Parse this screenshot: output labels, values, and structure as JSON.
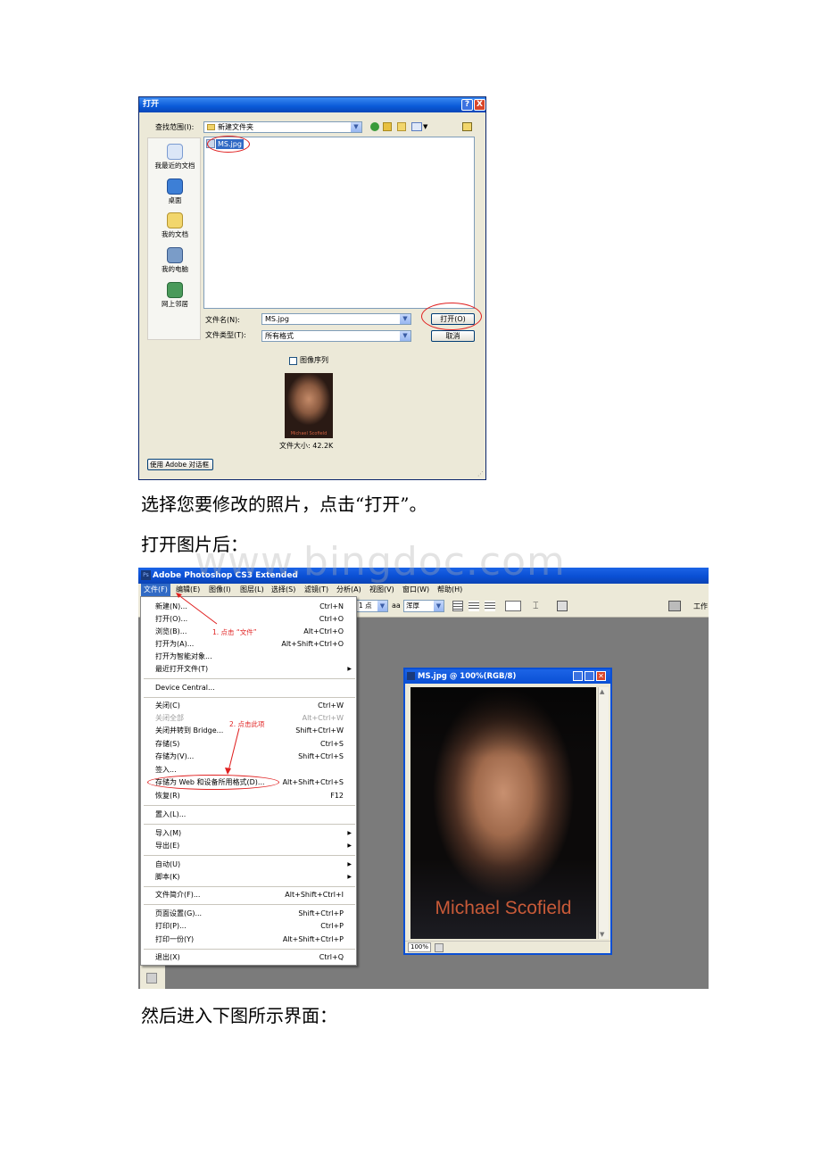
{
  "open_dialog": {
    "title": "打开",
    "help_btn": "?",
    "close_btn": "X",
    "look_in_label": "查找范围(I):",
    "look_in_value": "新建文件夹",
    "places": [
      "我最近的文档",
      "桌面",
      "我的文档",
      "我的电脑",
      "网上邻居"
    ],
    "file_item": "MS.jpg",
    "filename_label": "文件名(N):",
    "filename_value": "MS.jpg",
    "filetype_label": "文件类型(T):",
    "filetype_value": "所有格式",
    "open_button": "打开(O)",
    "cancel_button": "取消",
    "image_sequence_label": "图像序列",
    "file_size": "文件大小: 42.2K",
    "adobe_dialog_button": "使用 Adobe 对话框",
    "preview_caption": "Michael Scofield"
  },
  "paragraph1": "选择您要修改的照片，点击“打开”。",
  "paragraph2": "打开图片后：",
  "watermark": "www.bingdoc.com",
  "photoshop": {
    "title": "Adobe Photoshop CS3 Extended",
    "menubar": [
      "文件(F)",
      "编辑(E)",
      "图像(I)",
      "图层(L)",
      "选择(S)",
      "滤镜(T)",
      "分析(A)",
      "视图(V)",
      "窗口(W)",
      "帮助(H)"
    ],
    "options": {
      "size_value": "1 点",
      "aa_label": "aa",
      "aa_value": "浑厚",
      "workspace_label": "工作"
    },
    "file_menu": [
      {
        "label": "新建(N)...",
        "shortcut": "Ctrl+N"
      },
      {
        "label": "打开(O)...",
        "shortcut": "Ctrl+O"
      },
      {
        "label": "浏览(B)...",
        "shortcut": "Alt+Ctrl+O"
      },
      {
        "label": "打开为(A)...",
        "shortcut": "Alt+Shift+Ctrl+O"
      },
      {
        "label": "打开为智能对象...",
        "shortcut": ""
      },
      {
        "label": "最近打开文件(T)",
        "shortcut": "",
        "submenu": true
      },
      {
        "label": "Device Central...",
        "shortcut": ""
      },
      {
        "label": "关闭(C)",
        "shortcut": "Ctrl+W"
      },
      {
        "label": "关闭全部",
        "shortcut": "Alt+Ctrl+W",
        "disabled": true
      },
      {
        "label": "关闭并转到 Bridge...",
        "shortcut": "Shift+Ctrl+W"
      },
      {
        "label": "存储(S)",
        "shortcut": "Ctrl+S"
      },
      {
        "label": "存储为(V)...",
        "shortcut": "Shift+Ctrl+S"
      },
      {
        "label": "签入...",
        "shortcut": ""
      },
      {
        "label": "存储为 Web 和设备所用格式(D)...",
        "shortcut": "Alt+Shift+Ctrl+S"
      },
      {
        "label": "恢复(R)",
        "shortcut": "F12"
      },
      {
        "label": "置入(L)...",
        "shortcut": ""
      },
      {
        "label": "导入(M)",
        "shortcut": "",
        "submenu": true
      },
      {
        "label": "导出(E)",
        "shortcut": "",
        "submenu": true
      },
      {
        "label": "自动(U)",
        "shortcut": "",
        "submenu": true
      },
      {
        "label": "脚本(K)",
        "shortcut": "",
        "submenu": true
      },
      {
        "label": "文件简介(F)...",
        "shortcut": "Alt+Shift+Ctrl+I"
      },
      {
        "label": "页面设置(G)...",
        "shortcut": "Shift+Ctrl+P"
      },
      {
        "label": "打印(P)...",
        "shortcut": "Ctrl+P"
      },
      {
        "label": "打印一份(Y)",
        "shortcut": "Alt+Shift+Ctrl+P"
      },
      {
        "label": "退出(X)",
        "shortcut": "Ctrl+Q"
      }
    ],
    "annotation1": "1. 点击 “文件”",
    "annotation2": "2. 点击此项",
    "document": {
      "title": "MS.jpg @ 100%(RGB/8)",
      "photo_caption": "Michael Scofield",
      "zoom": "100%"
    }
  },
  "paragraph3": "然后进入下图所示界面：",
  "colors": {
    "xp_title": "#0a5ad8",
    "annotation_red": "#e02020",
    "ps_workspace": "#7b7b7b"
  }
}
